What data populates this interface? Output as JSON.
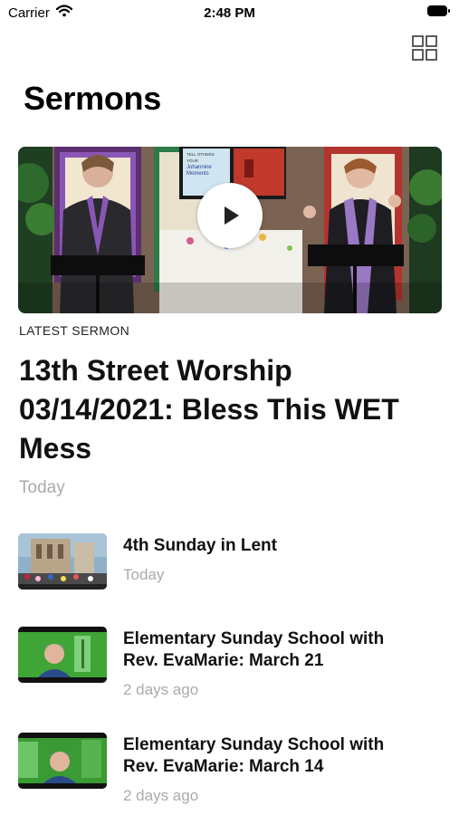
{
  "status_bar": {
    "carrier": "Carrier",
    "time": "2:48 PM"
  },
  "header": {
    "title": "Sermons",
    "layout_icon": "grid-view-icon"
  },
  "featured": {
    "label": "LATEST SERMON",
    "title": "13th Street Worship 03/14/2021: Bless This WET Mess",
    "date": "Today",
    "overlay_sign_text": [
      "TELL OTHERS",
      "YOUR",
      "Johannine",
      "Moments"
    ],
    "play_icon": "play-icon"
  },
  "sermons": [
    {
      "title": "4th Sunday in Lent",
      "date": "Today"
    },
    {
      "title": "Elementary Sunday School with Rev. EvaMarie: March 21",
      "date": "2 days ago"
    },
    {
      "title": "Elementary Sunday School with Rev. EvaMarie: March 14",
      "date": "2 days ago"
    }
  ],
  "colors": {
    "accent_purple": "#8a56b5",
    "secondary_text": "#aaaaaa",
    "thumb_green": "#3fa536"
  }
}
